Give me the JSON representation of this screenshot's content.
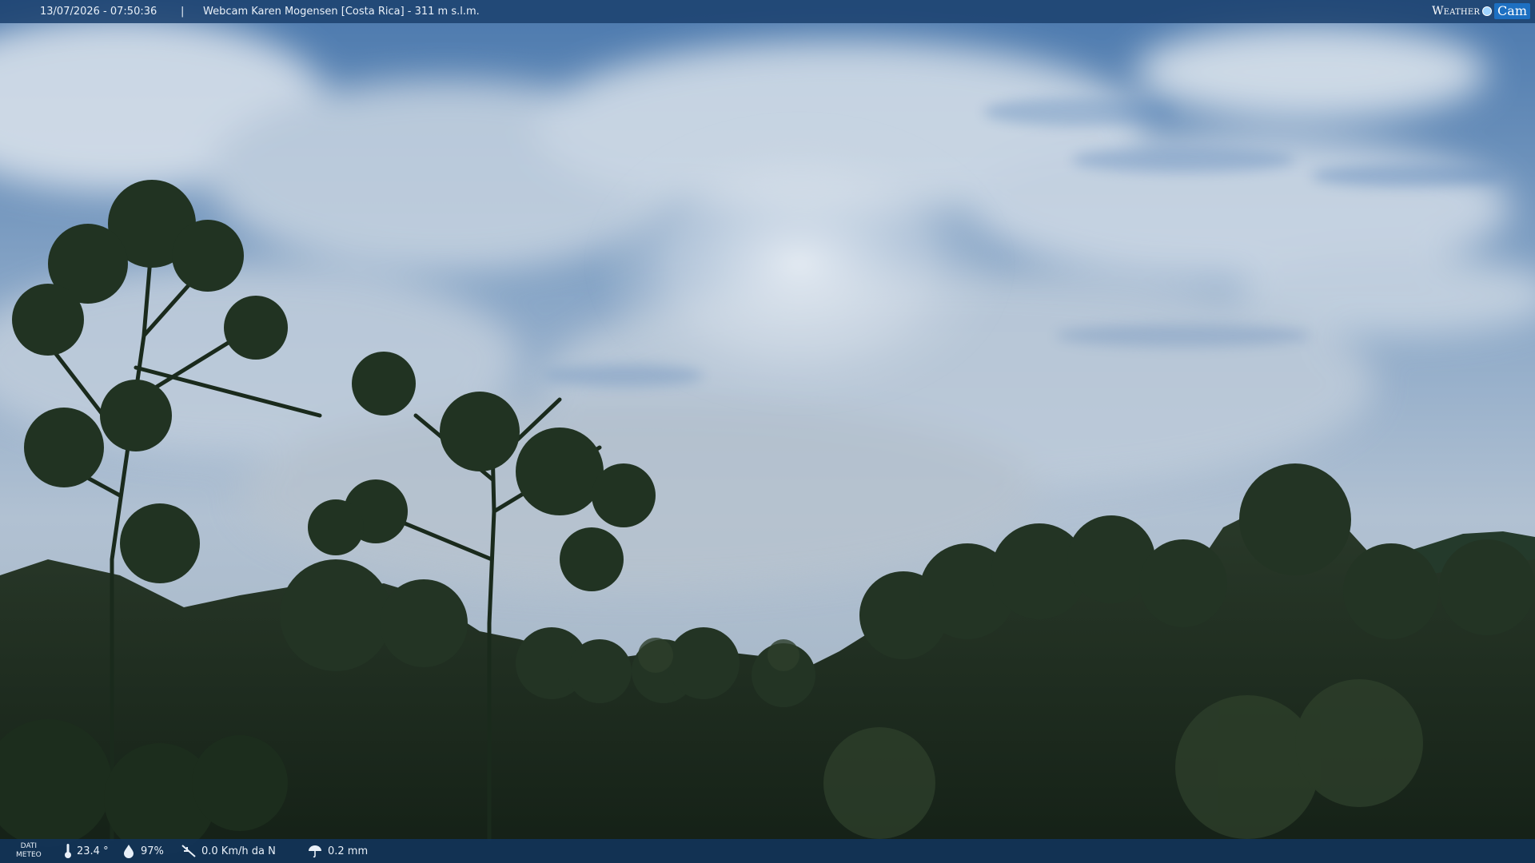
{
  "overlay": {
    "datetime": "13/07/2026 - 07:50:36",
    "separator": "|",
    "title": "Webcam Karen Mogensen [Costa Rica] - 311 m s.l.m.",
    "logo": {
      "weather": "Weather",
      "cam": "Cam"
    }
  },
  "meteo": {
    "label_line1": "DATI",
    "label_line2": "METEO",
    "temperature": "23.4 °",
    "humidity": "97%",
    "wind": "0.0 Km/h da N",
    "rain": "0.2 mm"
  },
  "colors": {
    "bar_top": "#1c4270",
    "bar_bottom": "#12345c",
    "sky_top": "#3f6fa8",
    "sky_bottom": "#b8c6d4",
    "foliage": "#1f2f20"
  },
  "icons": {
    "temperature": "thermometer-icon",
    "humidity": "water-drop-icon",
    "wind": "wind-vane-icon",
    "rain": "umbrella-icon"
  }
}
